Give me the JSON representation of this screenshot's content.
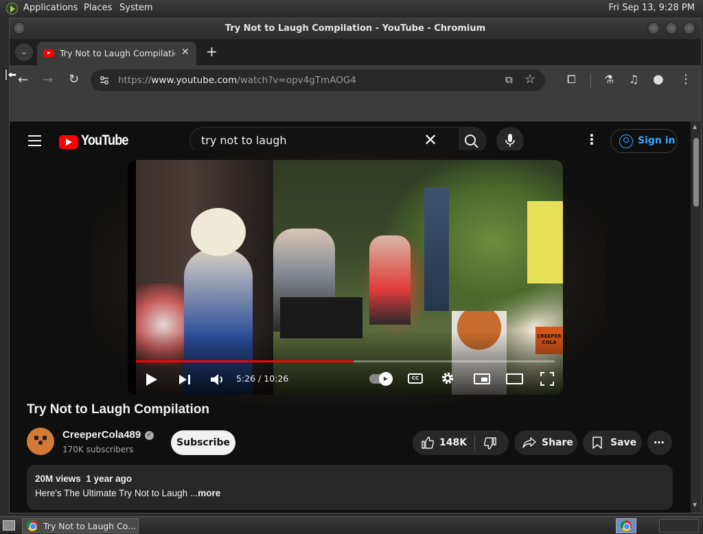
{
  "top_panel": {
    "menus": [
      "Applications",
      "Places",
      "System"
    ],
    "clock": "Fri Sep 13,  9:28 PM"
  },
  "window": {
    "title": "Try Not to Laugh Compilation - YouTube - Chromium"
  },
  "tabs": [
    {
      "title": "Try Not to Laugh Compilation - YouTube",
      "close": "✕"
    }
  ],
  "tabstrip": {
    "tab_search": "⌄",
    "new_tab": "+"
  },
  "toolbar": {
    "url_scheme": "https://",
    "url_host": "www.youtube.com",
    "url_path": "/watch?v=opv4gTmAOG4",
    "back": "←",
    "forward": "→",
    "reload": "↻",
    "cast": "⧉",
    "bookmark": "☆",
    "extensions": "⧠",
    "labs": "⚗",
    "media": "♫",
    "profile": "●",
    "menu": "⋮"
  },
  "youtube": {
    "logo_text": "YouTube",
    "search": {
      "value": "try not to laugh",
      "clear": "✕",
      "icon": "⌕"
    },
    "more": "⋮",
    "sign_in": "Sign in",
    "player": {
      "current_time": "5:26",
      "duration": "10:26",
      "time_display": "5:26 / 10:26",
      "progress": 0.52,
      "cc_label": "CC",
      "watermark": "CREEPER COLA"
    },
    "video_title": "Try Not to Laugh Compilation",
    "channel": {
      "name": "CreeperCola489",
      "subscribers": "170K subscribers",
      "verified": "✓"
    },
    "subscribe": "Subscribe",
    "actions": {
      "likes": "148K",
      "share": "Share",
      "save": "Save",
      "more": "⋯"
    },
    "description": {
      "views": "20M views",
      "age": "1 year ago",
      "text": "Here's The Ultimate Try Not to Laugh ...",
      "more": "more"
    }
  },
  "taskbar": {
    "task_label": "Try Not to Laugh Co..."
  },
  "colors": {
    "youtube_red": "#ff0000",
    "link_blue": "#3ea6ff",
    "page_bg": "#0f0f0f",
    "chrome_toolbar": "#3c3c3c"
  }
}
